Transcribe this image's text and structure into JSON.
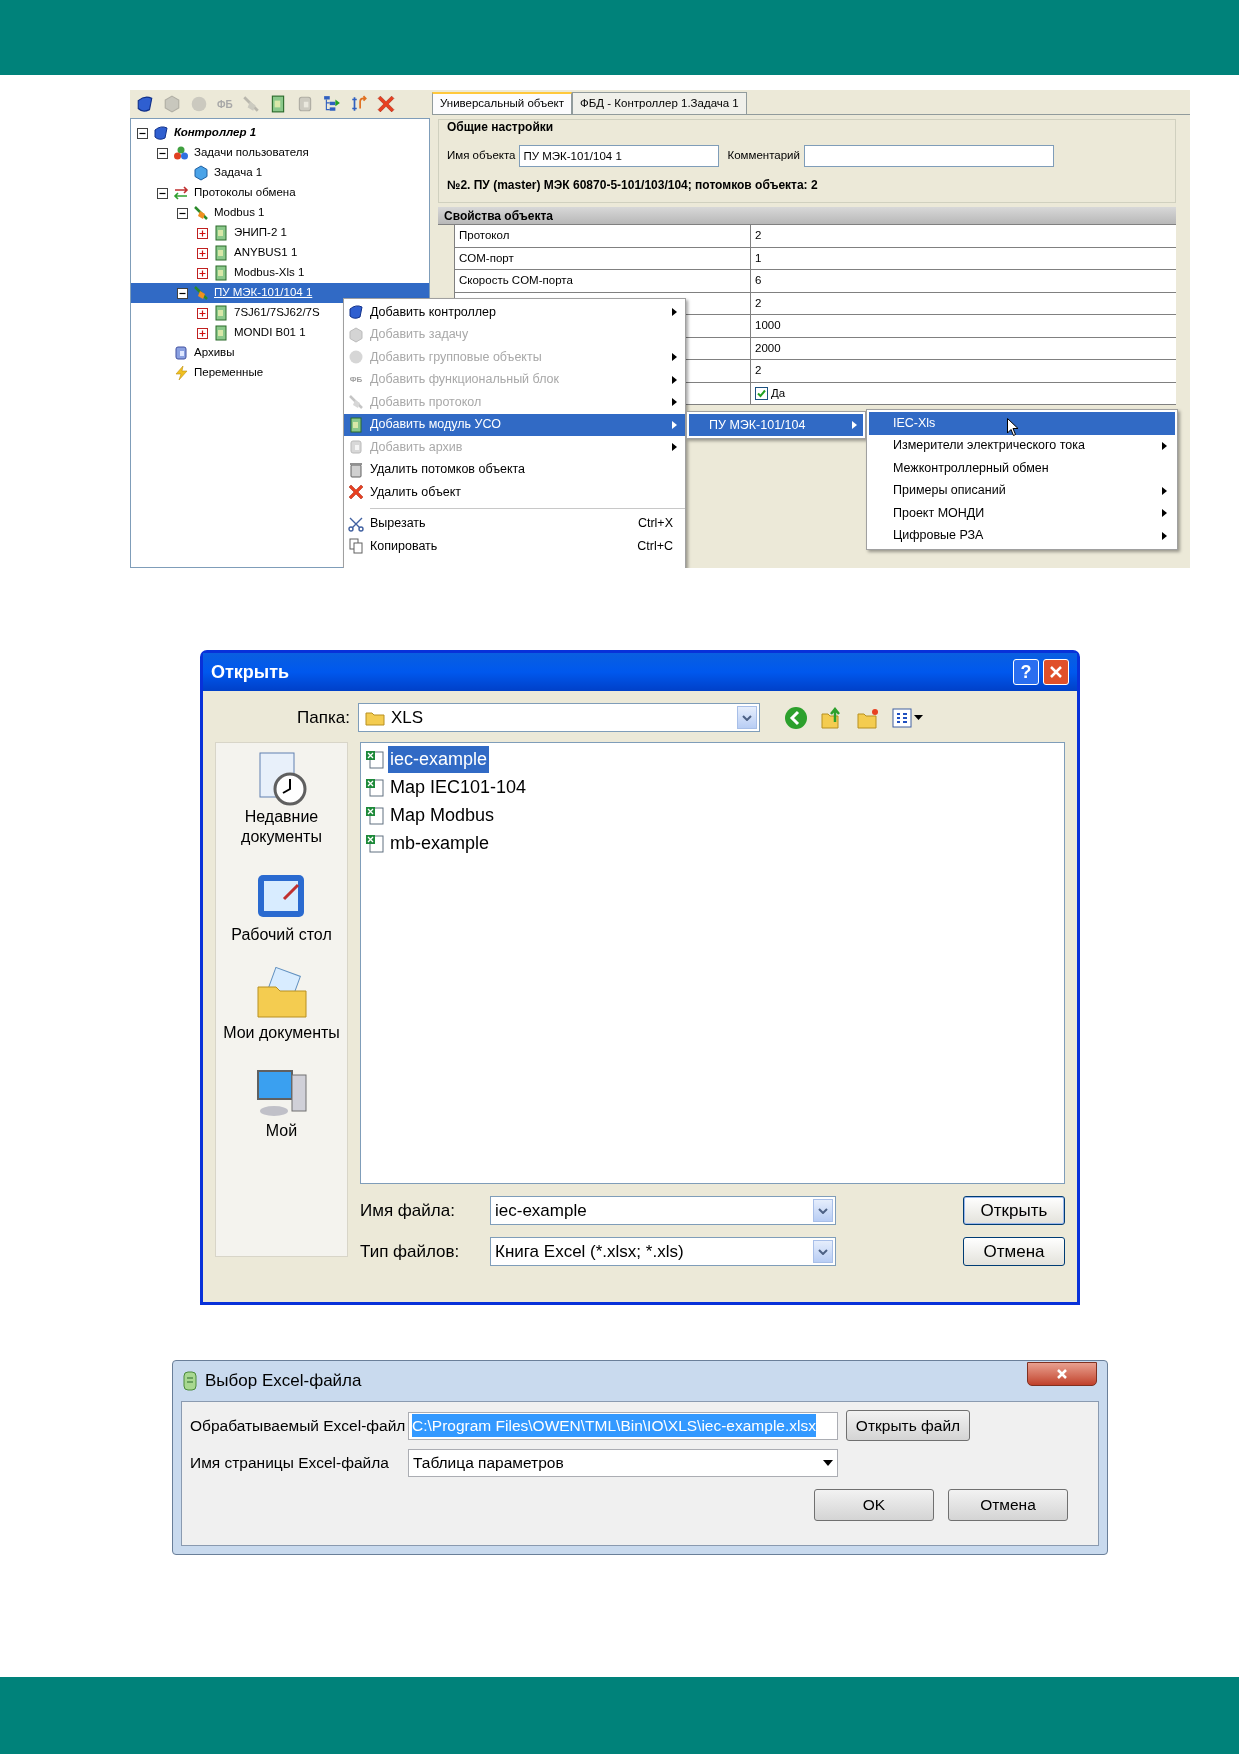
{
  "toolbar": [
    {
      "kind": "controller",
      "disabled": false
    },
    {
      "kind": "task",
      "disabled": true
    },
    {
      "kind": "group",
      "disabled": true
    },
    {
      "kind": "fb",
      "text": "ФБ",
      "disabled": true
    },
    {
      "kind": "protocol",
      "disabled": true
    },
    {
      "kind": "module",
      "disabled": false
    },
    {
      "kind": "archive",
      "disabled": true
    },
    {
      "kind": "tree",
      "disabled": false
    },
    {
      "kind": "sort",
      "disabled": false
    },
    {
      "kind": "delete",
      "disabled": false
    }
  ],
  "tree": [
    {
      "label": "Контроллер 1",
      "kind": "controller",
      "expanded": true,
      "selected": false,
      "children": [
        {
          "label": "Задачи пользователя",
          "kind": "tasks",
          "expanded": true,
          "selected": false,
          "children": [
            {
              "label": "Задача 1",
              "kind": "task",
              "selected": false
            }
          ]
        },
        {
          "label": "Протоколы обмена",
          "kind": "protocols",
          "expanded": true,
          "selected": false,
          "children": [
            {
              "label": "Modbus 1",
              "kind": "protocol",
              "expanded": true,
              "selected": false,
              "children": [
                {
                  "label": "ЭНИП-2 1",
                  "kind": "module",
                  "expanded": false,
                  "selected": false
                },
                {
                  "label": "ANYBUS1 1",
                  "kind": "module",
                  "expanded": false,
                  "selected": false
                },
                {
                  "label": "Modbus-Xls 1",
                  "kind": "module",
                  "expanded": false,
                  "selected": false
                }
              ]
            },
            {
              "label": "ПУ МЭК-101/104 1",
              "kind": "protocol",
              "expanded": true,
              "selected": true,
              "children": [
                {
                  "label": "7SJ61/7SJ62/7S",
                  "kind": "module",
                  "expanded": false,
                  "selected": false
                },
                {
                  "label": "MONDI B01 1",
                  "kind": "module",
                  "expanded": false,
                  "selected": false
                }
              ]
            }
          ]
        },
        {
          "label": "Архивы",
          "kind": "archive",
          "selected": false
        },
        {
          "label": "Переменные",
          "kind": "variables",
          "selected": false
        }
      ]
    }
  ],
  "tabs": [
    {
      "label": "Универсальный объект",
      "selected": true
    },
    {
      "label": "ФБД - Контроллер 1.Задача 1",
      "selected": false
    }
  ],
  "general": {
    "title": "Общие настройки",
    "name_label": "Имя объекта",
    "name_value": "ПУ МЭК-101/104 1",
    "comment_label": "Комментарий",
    "info": "№2. ПУ (master) МЭК 60870-5-101/103/104; потомков объекта: 2"
  },
  "properties": {
    "title": "Свойства объекта",
    "rows": [
      {
        "kind": "text",
        "name": "Протокол",
        "value": "2"
      },
      {
        "kind": "text",
        "name": "COM-порт",
        "value": "1"
      },
      {
        "kind": "text",
        "name": "Скорость COM-порта",
        "value": "6"
      },
      {
        "kind": "text",
        "value": "2"
      },
      {
        "kind": "text",
        "value": "1000"
      },
      {
        "kind": "text",
        "value": "2000"
      },
      {
        "kind": "text",
        "value": "2"
      },
      {
        "kind": "checkbox",
        "checked": true,
        "value": "Да"
      }
    ]
  },
  "context_menu": [
    {
      "kind": "controller",
      "label": "Добавить контроллер",
      "disabled": false,
      "submenu": true,
      "selected": false
    },
    {
      "kind": "task",
      "label": "Добавить задачу",
      "disabled": true,
      "submenu": false,
      "selected": false
    },
    {
      "kind": "group",
      "label": "Добавить групповые объекты",
      "disabled": true,
      "submenu": true,
      "selected": false
    },
    {
      "kind": "fb",
      "icon_text": "ФБ",
      "label": "Добавить функциональный блок",
      "disabled": true,
      "submenu": true,
      "selected": false
    },
    {
      "kind": "protocol",
      "label": "Добавить протокол",
      "disabled": true,
      "submenu": true,
      "selected": false
    },
    {
      "kind": "module",
      "label": "Добавить модуль УСО",
      "disabled": false,
      "submenu": true,
      "selected": true
    },
    {
      "kind": "archive",
      "label": "Добавить архив",
      "disabled": true,
      "submenu": true,
      "selected": false
    },
    {
      "kind": "trash",
      "label": "Удалить потомков объекта",
      "disabled": false,
      "submenu": false,
      "selected": false
    },
    {
      "kind": "delete",
      "label": "Удалить объект",
      "disabled": false,
      "submenu": false,
      "selected": false
    },
    {
      "kind": "separator"
    },
    {
      "kind": "cut",
      "label": "Вырезать",
      "shortcut": "Ctrl+X",
      "disabled": false,
      "submenu": false,
      "selected": false
    },
    {
      "kind": "copy",
      "label": "Копировать",
      "shortcut": "Ctrl+C",
      "disabled": false,
      "submenu": false,
      "selected": false
    }
  ],
  "submenu_1": [
    {
      "label": "ПУ МЭК-101/104",
      "selected": true,
      "submenu": true
    }
  ],
  "submenu_2": [
    {
      "label": "IEC-Xls",
      "selected": true,
      "submenu": false
    },
    {
      "label": "Измерители электрического тока",
      "selected": false,
      "submenu": true
    },
    {
      "label": "Межконтроллерный обмен",
      "selected": false,
      "submenu": false
    },
    {
      "label": "Примеры описаний",
      "selected": false,
      "submenu": true
    },
    {
      "label": "Проект МОНДИ",
      "selected": false,
      "submenu": true
    },
    {
      "label": "Цифровые РЗА",
      "selected": false,
      "submenu": true
    }
  ],
  "open_dialog": {
    "title": "Открыть",
    "help_button": "?",
    "folder_label": "Папка:",
    "folder": "XLS",
    "places": [
      {
        "kind": "recent",
        "label": "Недавние документы"
      },
      {
        "kind": "desktop",
        "label": "Рабочий стол"
      },
      {
        "kind": "documents",
        "label": "Мои документы"
      },
      {
        "kind": "computer",
        "label": "Мой"
      }
    ],
    "files": [
      {
        "name": "iec-example",
        "selected": true
      },
      {
        "name": "Map IEC101-104",
        "selected": false
      },
      {
        "name": "Map Modbus",
        "selected": false
      },
      {
        "name": "mb-example",
        "selected": false
      }
    ],
    "filename_label": "Имя файла:",
    "filename": "iec-example",
    "filetype_label": "Тип файлов:",
    "filetype": "Книга Excel (*.xlsx; *.xls)",
    "buttons": [
      "Открыть",
      "Отмена"
    ]
  },
  "excel_dialog": {
    "title": "Выбор Excel-файла",
    "file_label": "Обрабатываемый Excel-файл",
    "file_path": "C:\\Program Files\\OWEN\\TML\\Bin\\IO\\XLS\\iec-example.xlsx",
    "open_button": "Открыть файл",
    "sheet_label": "Имя страницы Excel-файла",
    "sheet": "Таблица параметров",
    "buttons": [
      "OK",
      "Отмена"
    ]
  }
}
